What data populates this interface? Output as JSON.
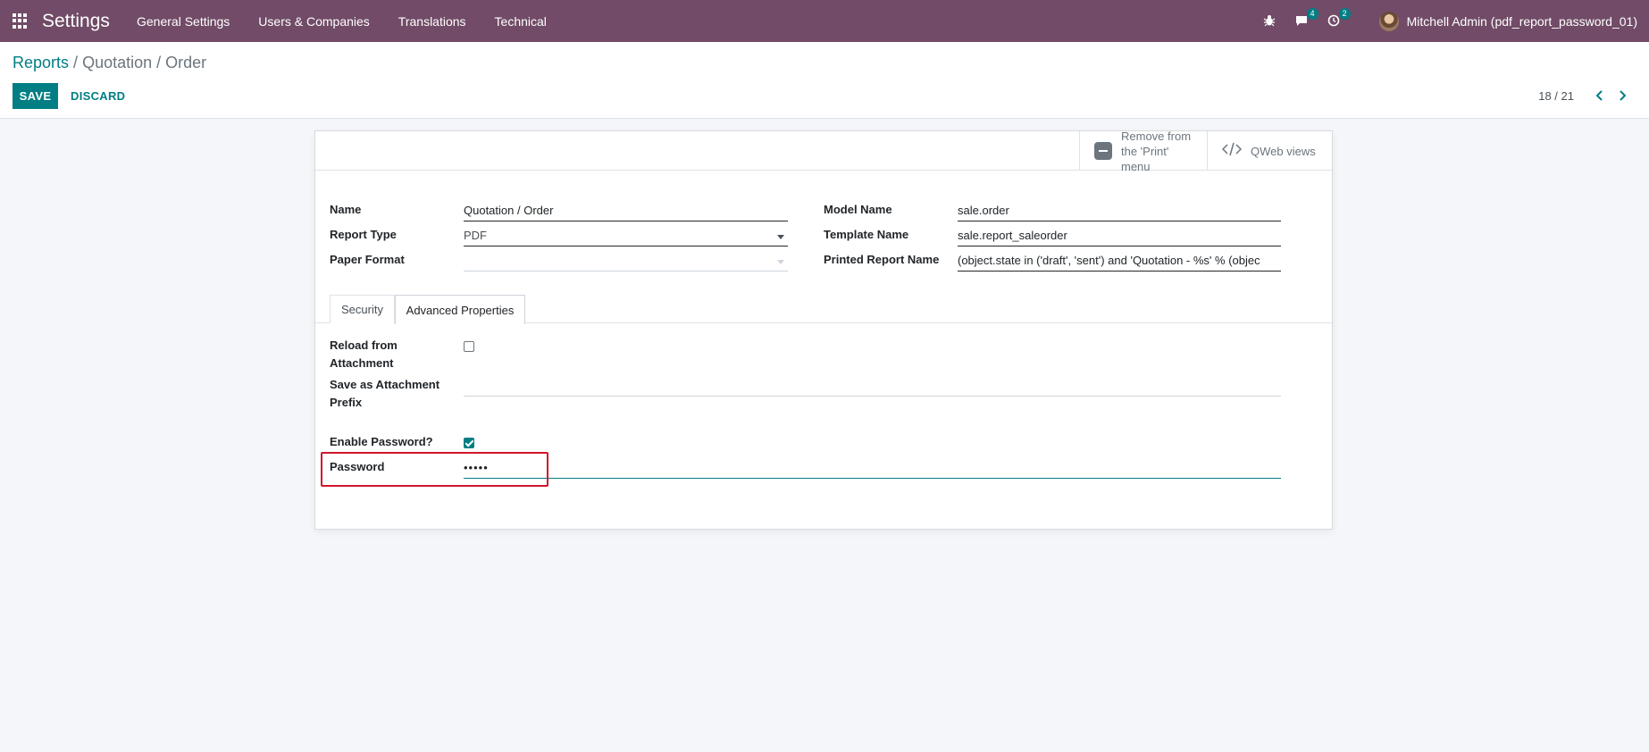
{
  "navbar": {
    "app_name": "Settings",
    "menu": [
      "General Settings",
      "Users & Companies",
      "Translations",
      "Technical"
    ],
    "icons": [
      "apps-icon",
      "bug-icon",
      "chat-icon",
      "activity-clock-icon"
    ],
    "messages_badge": "4",
    "activities_badge": "2",
    "user_name": "Mitchell Admin (pdf_report_password_01)",
    "bg_color": "#714b67"
  },
  "control_panel": {
    "breadcrumb_parent": "Reports",
    "breadcrumb_separator": "/",
    "breadcrumb_current": "Quotation / Order",
    "save_label": "SAVE",
    "discard_label": "DISCARD",
    "pager_value": "18 / 21",
    "accent_color": "#017e84"
  },
  "button_box": {
    "remove_print_label": "Remove from the 'Print' menu",
    "qweb_views_label": "QWeb views"
  },
  "form": {
    "name_label": "Name",
    "name_value": "Quotation / Order",
    "report_type_label": "Report Type",
    "report_type_value": "PDF",
    "paper_format_label": "Paper Format",
    "paper_format_value": "",
    "model_name_label": "Model Name",
    "model_name_value": "sale.order",
    "template_name_label": "Template Name",
    "template_name_value": "sale.report_saleorder",
    "printed_report_name_label": "Printed Report Name",
    "printed_report_name_value": "(object.state in ('draft', 'sent') and 'Quotation - %s' % (objec"
  },
  "tabs": {
    "security": "Security",
    "advanced": "Advanced Properties",
    "active": "advanced"
  },
  "advanced": {
    "reload_label_line1": "Reload from",
    "reload_label_line2": "Attachment",
    "reload_checked": false,
    "save_prefix_label_line1": "Save as Attachment",
    "save_prefix_label_line2": "Prefix",
    "save_prefix_value": "",
    "enable_password_label": "Enable Password?",
    "enable_password_checked": true,
    "password_label": "Password",
    "password_value": "•••••",
    "highlight_color": "#d0162b"
  }
}
